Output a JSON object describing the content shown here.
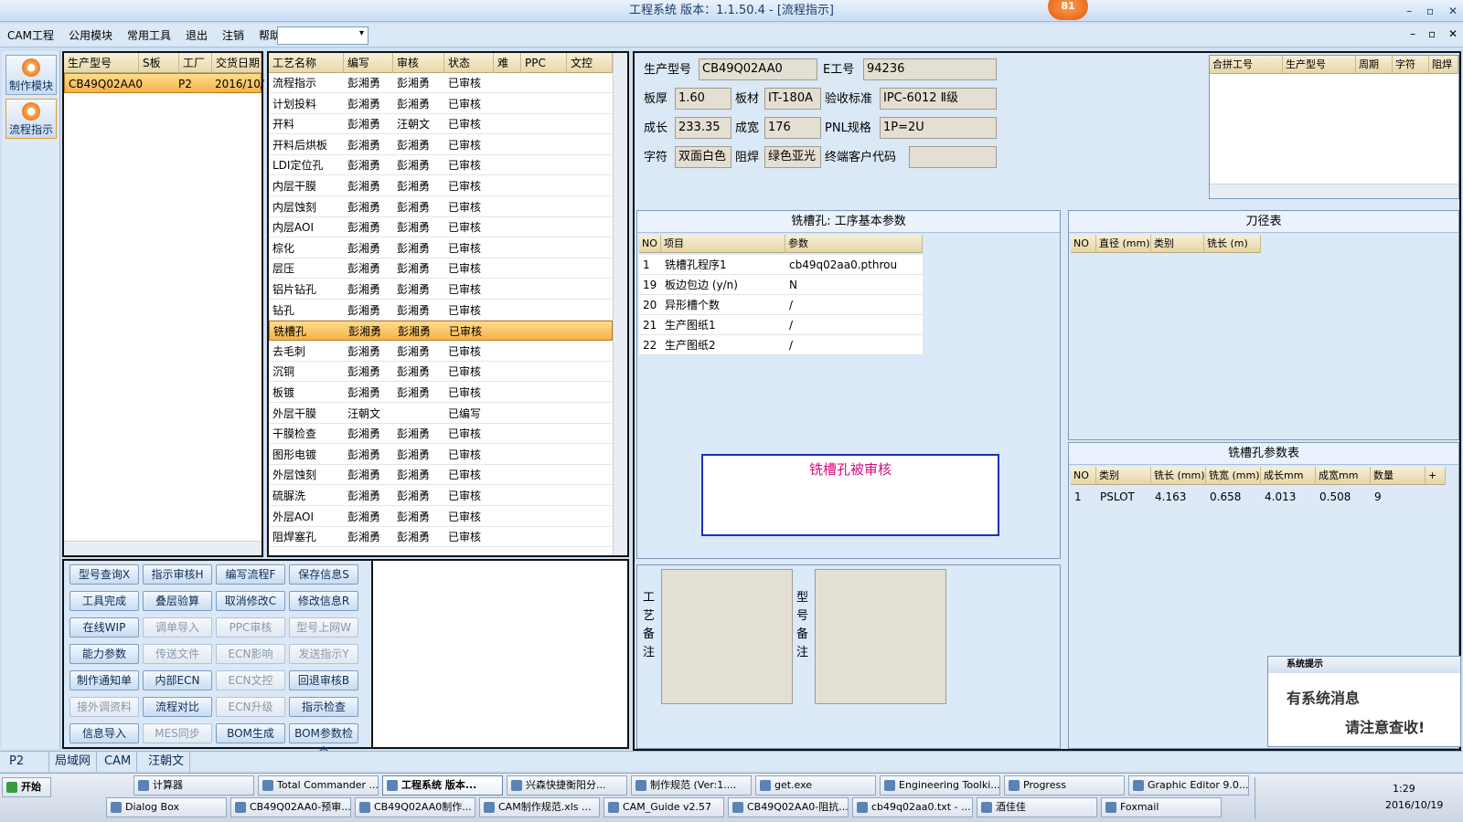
{
  "title": {
    "text": "工程系统   版本：1.1.50.4 - [流程指示]",
    "badge": "81",
    "win_btns": [
      "–",
      "▫",
      "✕"
    ]
  },
  "menu": {
    "items": [
      "CAM工程",
      "公用模块",
      "常用工具",
      "退出",
      "注销",
      "帮助"
    ],
    "help_arrow": "▾",
    "mdi_btns": [
      "–",
      "▫",
      "✕"
    ]
  },
  "leftnav": {
    "make": "制作模块",
    "flow": "流程指示"
  },
  "models": {
    "headers": [
      "生产型号",
      "S板",
      "工厂",
      "交货日期"
    ],
    "rows": [
      [
        "CB49Q02AA0",
        "",
        "P2",
        "2016/10/"
      ]
    ]
  },
  "steps": {
    "headers": [
      "工艺名称",
      "编写",
      "审核",
      "状态",
      "难",
      "PPC",
      "文控"
    ],
    "rows": [
      [
        "流程指示",
        "彭湘勇",
        "彭湘勇",
        "已审核"
      ],
      [
        "计划投料",
        "彭湘勇",
        "彭湘勇",
        "已审核"
      ],
      [
        "开料",
        "彭湘勇",
        "汪朝文",
        "已审核"
      ],
      [
        "开料后烘板",
        "彭湘勇",
        "彭湘勇",
        "已审核"
      ],
      [
        "LDI定位孔",
        "彭湘勇",
        "彭湘勇",
        "已审核"
      ],
      [
        "内层干膜",
        "彭湘勇",
        "彭湘勇",
        "已审核"
      ],
      [
        "内层蚀刻",
        "彭湘勇",
        "彭湘勇",
        "已审核"
      ],
      [
        "内层AOI",
        "彭湘勇",
        "彭湘勇",
        "已审核"
      ],
      [
        "棕化",
        "彭湘勇",
        "彭湘勇",
        "已审核"
      ],
      [
        "层压",
        "彭湘勇",
        "彭湘勇",
        "已审核"
      ],
      [
        "铝片钻孔",
        "彭湘勇",
        "彭湘勇",
        "已审核"
      ],
      [
        "钻孔",
        "彭湘勇",
        "彭湘勇",
        "已审核"
      ],
      [
        "铣槽孔",
        "彭湘勇",
        "彭湘勇",
        "已审核"
      ],
      [
        "去毛刺",
        "彭湘勇",
        "彭湘勇",
        "已审核"
      ],
      [
        "沉铜",
        "彭湘勇",
        "彭湘勇",
        "已审核"
      ],
      [
        "板镀",
        "彭湘勇",
        "彭湘勇",
        "已审核"
      ],
      [
        "外层干膜",
        "汪朝文",
        "",
        "已编写"
      ],
      [
        "干膜检查",
        "彭湘勇",
        "彭湘勇",
        "已审核"
      ],
      [
        "图形电镀",
        "彭湘勇",
        "彭湘勇",
        "已审核"
      ],
      [
        "外层蚀刻",
        "彭湘勇",
        "彭湘勇",
        "已审核"
      ],
      [
        "硫脲洗",
        "彭湘勇",
        "彭湘勇",
        "已审核"
      ],
      [
        "外层AOI",
        "彭湘勇",
        "彭湘勇",
        "已审核"
      ],
      [
        "阻焊塞孔",
        "彭湘勇",
        "彭湘勇",
        "已审核"
      ]
    ],
    "selected_index": 12
  },
  "buttons": [
    [
      "型号查询X",
      "指示审核H",
      "编写流程F",
      "保存信息S"
    ],
    [
      "工具完成",
      "叠层验算",
      "取消修改C",
      "修改信息R"
    ],
    [
      "在线WIP",
      "调单导入",
      "PPC审核",
      "型号上网W"
    ],
    [
      "能力参数",
      "传送文件",
      "ECN影响",
      "发送指示Y"
    ],
    [
      "制作通知单",
      "内部ECN",
      "ECN文控",
      "回退审核B"
    ],
    [
      "接外调资料",
      "流程对比",
      "ECN升级",
      "指示检查"
    ],
    [
      "信息导入",
      "MES同步",
      "BOM生成",
      "BOM参数检查"
    ]
  ],
  "info": {
    "model_label": "生产型号",
    "model": "CB49Q02AA0",
    "eno_label": "E工号",
    "eno": "94236",
    "thick_label": "板厚",
    "thick": "1.60",
    "mat_label": "板材",
    "mat": "IT-180A",
    "std_label": "验收标准",
    "std": "IPC-6012 Ⅱ级",
    "len_label": "成长",
    "len": "233.35",
    "wid_label": "成宽",
    "wid": "176",
    "pnl_label": "PNL规格",
    "pnl": "1P=2U",
    "char_label": "字符",
    "char": "双面白色",
    "mask_label": "阻焊",
    "mask": "绿色亚光",
    "cust_label": "终端客户代码",
    "cust": ""
  },
  "merge": {
    "headers": [
      "合拼工号",
      "生产型号",
      "周期",
      "字符",
      "阻焊"
    ]
  },
  "params": {
    "title": "铣槽孔: 工序基本参数",
    "headers": [
      "NO",
      "项目",
      "参数"
    ],
    "rows": [
      [
        "1",
        "铣槽孔程序1",
        "cb49q02aa0.pthrou"
      ],
      [
        "19",
        "板边包边 (y/n)",
        "N"
      ],
      [
        "20",
        "异形槽个数",
        "/"
      ],
      [
        "21",
        "生产图纸1",
        "/"
      ],
      [
        "22",
        "生产图纸2",
        "/"
      ]
    ],
    "message": "铣槽孔被审核"
  },
  "tools": {
    "title": "刀径表",
    "headers": [
      "NO",
      "直径 (mm)",
      "类别",
      "铣长 (m)"
    ]
  },
  "slot": {
    "title": "铣槽孔参数表",
    "headers": [
      "NO",
      "类别",
      "铣长 (mm)",
      "铣宽 (mm)",
      "成长mm",
      "成宽mm",
      "数量",
      "+"
    ],
    "rows": [
      [
        "1",
        "PSLOT",
        "4.163",
        "0.658",
        "4.013",
        "0.508",
        "9"
      ]
    ]
  },
  "notes": {
    "craft": "工艺备注",
    "model": "型号备注"
  },
  "notif": {
    "title": "系统提示",
    "line1": "有系统消息",
    "line2": "请注意查收!"
  },
  "status": {
    "p2": "P2",
    "lan": "局域网",
    "cam": "CAM",
    "user": "汪朝文"
  },
  "taskbar": {
    "start": "开始",
    "row1": [
      "计算器",
      "Total Commander ...",
      "工程系统  版本...",
      "兴森快捷衡阳分...",
      "制作规范 (Ver:1....",
      "get.exe",
      "Engineering Toolki...",
      "Progress",
      "Graphic Editor 9.0...."
    ],
    "row2": [
      "Dialog Box",
      "CB49Q02AA0-预审...",
      "CB49Q02AA0制作...",
      "CAM制作规范.xls ...",
      "CAM_Guide v2.57",
      "CB49Q02AA0-阻抗...",
      "cb49q02aa0.txt - ...",
      "酒佳佳",
      "Foxmail"
    ],
    "time": "1:29",
    "date": "2016/10/19"
  }
}
